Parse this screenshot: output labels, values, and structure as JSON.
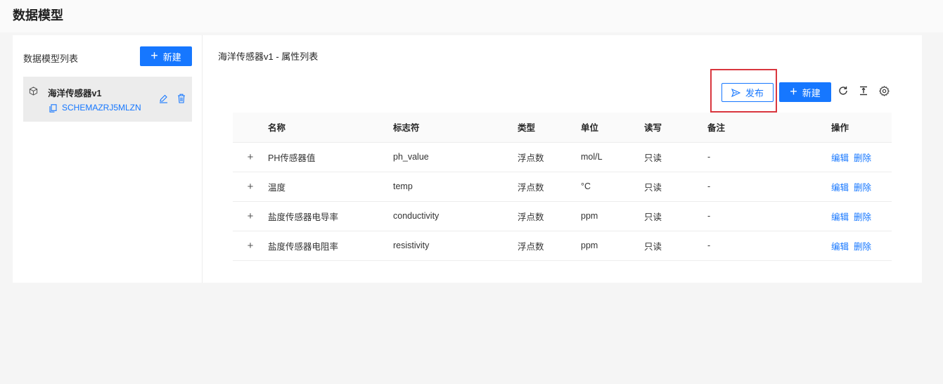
{
  "page": {
    "title": "数据模型"
  },
  "left": {
    "title": "数据模型列表",
    "new_label": "新建",
    "model": {
      "name": "海洋传感器v1",
      "code": "SCHEMAZRJ5MLZN"
    }
  },
  "right": {
    "title": "海洋传感器v1 - 属性列表",
    "publish_label": "发布",
    "new_label": "新建"
  },
  "table": {
    "headers": [
      "名称",
      "标志符",
      "类型",
      "单位",
      "读写",
      "备注",
      "操作"
    ],
    "rows": [
      {
        "name": "PH传感器值",
        "id": "ph_value",
        "type": "浮点数",
        "unit": "mol/L",
        "rw": "只读",
        "note": "-",
        "edit": "编辑",
        "del": "删除"
      },
      {
        "name": "温度",
        "id": "temp",
        "type": "浮点数",
        "unit": "°C",
        "rw": "只读",
        "note": "-",
        "edit": "编辑",
        "del": "删除"
      },
      {
        "name": "盐度传感器电导率",
        "id": "conductivity",
        "type": "浮点数",
        "unit": "ppm",
        "rw": "只读",
        "note": "-",
        "edit": "编辑",
        "del": "删除"
      },
      {
        "name": "盐度传感器电阻率",
        "id": "resistivity",
        "type": "浮点数",
        "unit": "ppm",
        "rw": "只读",
        "note": "-",
        "edit": "编辑",
        "del": "删除"
      }
    ]
  },
  "colors": {
    "primary": "#1677ff",
    "highlight": "#d9363e"
  }
}
